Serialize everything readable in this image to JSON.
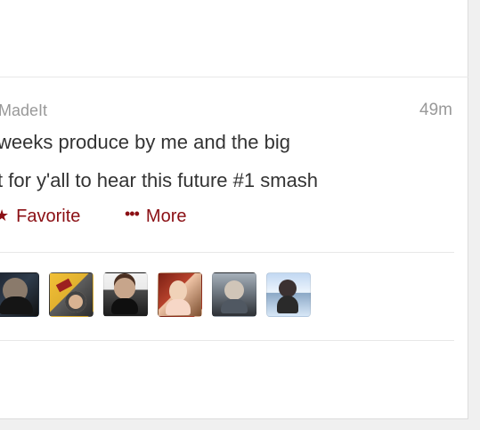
{
  "tweet": {
    "author_partial": "MadeIt",
    "time": "49m",
    "line_1": "weeks produce by me and the big",
    "line_2": "t for y'all to hear this future #1 smash"
  },
  "actions": {
    "favorite_label": "Favorite",
    "more_label": "More",
    "favorite_icon": "star-icon",
    "more_icon": "dots-icon",
    "accent_color": "#8b0f14"
  },
  "avatars": [
    {
      "name": "avatar-1"
    },
    {
      "name": "avatar-2"
    },
    {
      "name": "avatar-3"
    },
    {
      "name": "avatar-4"
    },
    {
      "name": "avatar-5"
    },
    {
      "name": "avatar-6"
    }
  ]
}
